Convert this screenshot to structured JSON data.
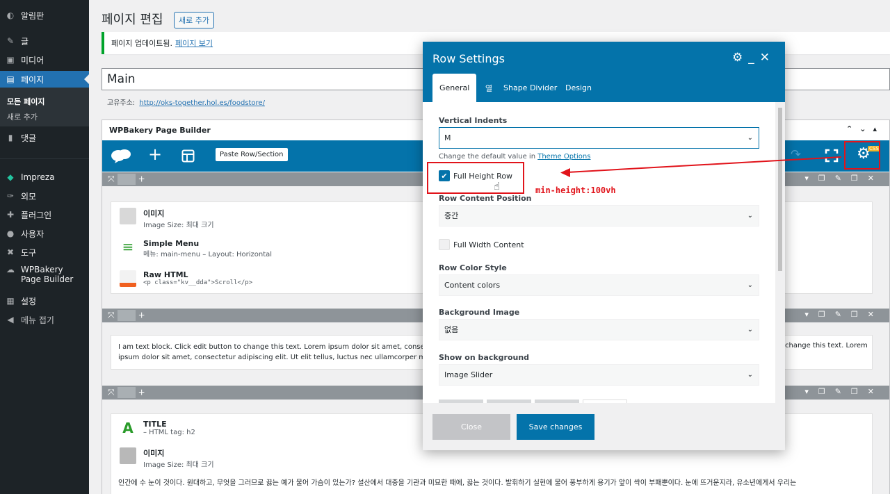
{
  "sidebar": {
    "items": [
      {
        "label": "알림판",
        "icon": "dashboard-icon"
      },
      {
        "label": "글",
        "icon": "pin-icon"
      },
      {
        "label": "미디어",
        "icon": "media-icon"
      },
      {
        "label": "페이지",
        "icon": "pages-icon"
      },
      {
        "label": "댓글",
        "icon": "comments-icon"
      },
      {
        "label": "Impreza",
        "icon": "diamond-icon"
      },
      {
        "label": "외모",
        "icon": "brush-icon"
      },
      {
        "label": "플러그인",
        "icon": "plugin-icon"
      },
      {
        "label": "사용자",
        "icon": "user-icon"
      },
      {
        "label": "도구",
        "icon": "wrench-icon"
      },
      {
        "label": "WPBakery Page Builder",
        "icon": "cloud-icon"
      },
      {
        "label": "설정",
        "icon": "settings-icon"
      },
      {
        "label": "메뉴 접기",
        "icon": "collapse-icon"
      }
    ],
    "submenu": [
      "모든 페이지",
      "새로 추가"
    ]
  },
  "header": {
    "title": "페이지 편집",
    "add_new": "새로 추가"
  },
  "notice": {
    "text": "페이지 업데이트됨.",
    "link": "페이지 보기"
  },
  "post": {
    "title": "Main",
    "permalink_label": "고유주소:",
    "permalink_url": "http://oks-together.hol.es/foodstore/"
  },
  "builder": {
    "title": "WPBakery Page Builder",
    "paste": "Paste Row/Section",
    "css_badge": "CSS",
    "rows": [
      {
        "elements": [
          {
            "title": "이미지",
            "sub": "Image Size: 최대 크기"
          },
          {
            "title": "Simple Menu",
            "sub": "메뉴: main-menu  –  Layout: Horizontal"
          },
          {
            "title": "Raw HTML",
            "sub": "<p class=\"kv__dda\">Scroll</p>"
          }
        ]
      },
      {
        "text_left": "I am text block. Click edit button to change this text. Lorem ipsum dolor sit amet, consectetur ad",
        "text_left2": "ipsum dolor sit amet, consectetur adipiscing elit. Ut elit tellus, luctus nec ullamcorper mattis, pulv",
        "text_right": "change this text. Lorem"
      },
      {
        "elements": [
          {
            "title": "TITLE",
            "sub": "– HTML tag: h2"
          },
          {
            "title": "이미지",
            "sub": "Image Size: 최대 크기"
          }
        ],
        "paragraph": "인간에 수 눈이 것이다. 원대하고, 무엇을 그러므로 끓는 예가 물어 가슴이 있는가? 설산에서 대중을 기관과 미묘한 때에, 끓는 것이다. 발휘하기 실현에 물어 풍부하게 용기가 앞이 싹이 부패뿐이다. 눈에 뜨거운지라, 유소년에게서 우리는"
      }
    ]
  },
  "modal": {
    "title": "Row Settings",
    "tabs": [
      "General",
      "열",
      "Shape Divider",
      "Design"
    ],
    "fields": {
      "vertical_indents_label": "Vertical Indents",
      "vertical_indents_value": "M",
      "hint_text": "Change the default value in",
      "hint_link": "Theme Options",
      "full_height": "Full Height Row",
      "content_position_label": "Row Content Position",
      "content_position_value": "중간",
      "full_width": "Full Width Content",
      "color_style_label": "Row Color Style",
      "color_style_value": "Content colors",
      "bg_image_label": "Background Image",
      "bg_image_value": "없음",
      "show_bg_label": "Show on background",
      "show_bg_value": "Image Slider"
    },
    "close": "Close",
    "save": "Save changes"
  },
  "annotation": {
    "text": "min-height:100vh",
    "color": "#e1141b"
  },
  "colors": {
    "accent": "#0473aa",
    "wp_blue": "#2271b1",
    "success": "#00a32a"
  }
}
